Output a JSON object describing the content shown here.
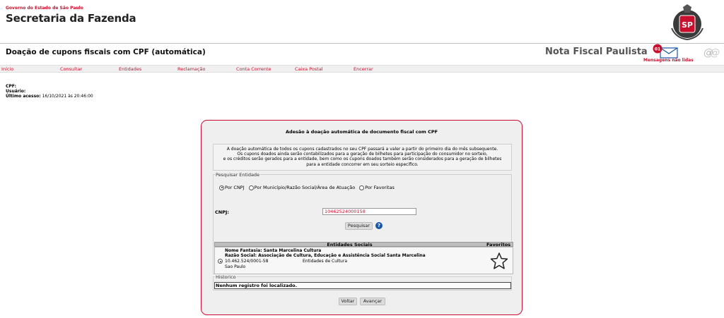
{
  "header": {
    "gov_line1": "Governo do Estado de São Paulo",
    "gov_line2": "Secretaria da Fazenda",
    "page_title": "Doação de cupons fiscais com CPF (automática)",
    "brand": "Nota Fiscal Paulista",
    "messages_badge": "01",
    "messages_label": "Mensagens não lidas",
    "crest_text": "SP"
  },
  "menu": [
    "Início",
    "Consultar",
    "Entidades",
    "Reclamação",
    "Conta Corrente",
    "Caixa Postal",
    "Encerrar"
  ],
  "user": {
    "cpf_label": "CPF:",
    "usuario_label": "Usuário:",
    "last_access_label": "Último acesso:",
    "last_access_value": "16/10/2021 às 20:46:00"
  },
  "panel": {
    "title": "Adesão à doação automática de documento fiscal com CPF",
    "description": [
      "A doação automática de todos os cupons cadastrados no seu CPF passará a valer a partir do primeiro dia do mês subsequente.",
      "Os cupons doados ainda serão contabilizados para a geração de bilhetes para participação do consumidor no sorteio,",
      "e os créditos serão gerados para a entidade, bem como os cupons doados também serão considerados para a geração de bilhetes",
      "para a entidade concorrer em seu sorteio específico."
    ],
    "search": {
      "legend": "Pesquisar Entidade",
      "options": [
        "Por CNPJ",
        "Por Município/Razão Social/Área de Atuação",
        "Por Favoritas"
      ],
      "selected": "Por CNPJ",
      "cnpj_label": "CNPJ:",
      "cnpj_value": "10462524000158",
      "search_button": "Pesquisar",
      "help_symbol": "?"
    },
    "table": {
      "headers": [
        "Entidades Sociais",
        "Favoritos"
      ],
      "rows": [
        {
          "fantasia": "Nome Fantasia: Santa Marcelina Cultura",
          "razao": "Razão Social: Associação de Cultura, Educação e Assistência Social Santa Marcelina",
          "cnpj": "10.462.524/0001-58",
          "categoria": "Entidades de Cultura",
          "cidade": "Sao Paulo"
        }
      ]
    },
    "history": {
      "legend": "Historico",
      "empty_text": "Nenhum registro foi localizado."
    },
    "buttons": {
      "back": "Voltar",
      "next": "Avançar"
    }
  },
  "colors": {
    "accent": "#c8102e",
    "help": "#1a56a6",
    "panel_bg": "#efefef"
  }
}
